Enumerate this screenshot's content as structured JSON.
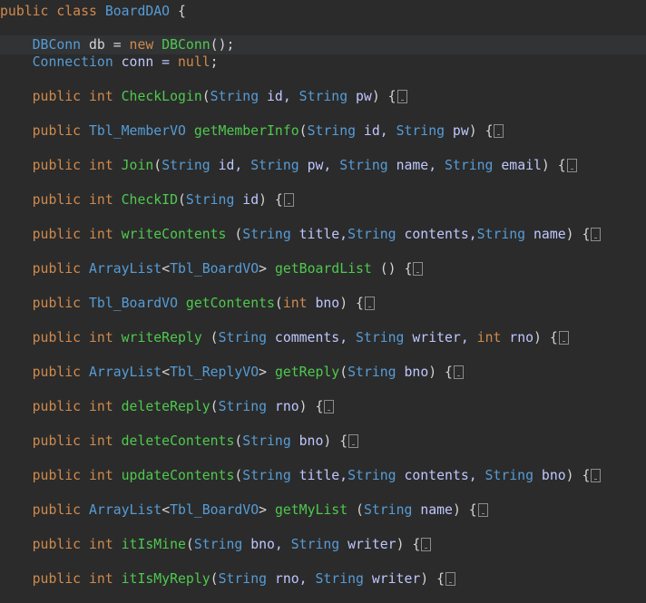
{
  "editor": {
    "colors": {
      "background": "#2b2b2b",
      "current_line": "#313335",
      "keyword": "#d08a4c",
      "type": "#569cd6",
      "method": "#4ec94e",
      "field": "#bfc7ff",
      "plain": "#d4d4d4"
    },
    "lines": [
      {
        "name": "class-declaration",
        "current": false,
        "collapsed": false,
        "tokens": [
          {
            "t": "public class ",
            "c": "keyword"
          },
          {
            "t": "BoardDAO",
            "c": "type"
          },
          {
            "t": " {",
            "c": "plain"
          }
        ]
      },
      {
        "name": "field-db",
        "current": true,
        "collapsed": false,
        "tokens": [
          {
            "t": "    ",
            "c": "plain"
          },
          {
            "t": "DBConn",
            "c": "type"
          },
          {
            "t": " db = ",
            "c": "plain"
          },
          {
            "t": "new",
            "c": "keyword"
          },
          {
            "t": " ",
            "c": "plain"
          },
          {
            "t": "DBConn",
            "c": "method"
          },
          {
            "t": "();",
            "c": "plain"
          }
        ]
      },
      {
        "name": "field-conn",
        "current": false,
        "collapsed": false,
        "tokens": [
          {
            "t": "    ",
            "c": "plain"
          },
          {
            "t": "Connection",
            "c": "type"
          },
          {
            "t": " conn = ",
            "c": "field"
          },
          {
            "t": "null",
            "c": "keyword"
          },
          {
            "t": ";",
            "c": "plain"
          }
        ]
      },
      {
        "name": "method-checklogin",
        "current": false,
        "collapsed": true,
        "tokens": [
          {
            "t": "    ",
            "c": "plain"
          },
          {
            "t": "public int ",
            "c": "keyword"
          },
          {
            "t": "CheckLogin",
            "c": "method"
          },
          {
            "t": "(",
            "c": "plain"
          },
          {
            "t": "String",
            "c": "type"
          },
          {
            "t": " id, ",
            "c": "field"
          },
          {
            "t": "String",
            "c": "type"
          },
          {
            "t": " pw",
            "c": "field"
          },
          {
            "t": ") {",
            "c": "plain"
          }
        ]
      },
      {
        "name": "method-getmemberinfo",
        "current": false,
        "collapsed": true,
        "tokens": [
          {
            "t": "    ",
            "c": "plain"
          },
          {
            "t": "public ",
            "c": "keyword"
          },
          {
            "t": "Tbl_MemberVO",
            "c": "type"
          },
          {
            "t": " ",
            "c": "plain"
          },
          {
            "t": "getMemberInfo",
            "c": "method"
          },
          {
            "t": "(",
            "c": "plain"
          },
          {
            "t": "String",
            "c": "type"
          },
          {
            "t": " id, ",
            "c": "field"
          },
          {
            "t": "String",
            "c": "type"
          },
          {
            "t": " pw",
            "c": "field"
          },
          {
            "t": ") {",
            "c": "plain"
          }
        ]
      },
      {
        "name": "method-join",
        "current": false,
        "collapsed": true,
        "tokens": [
          {
            "t": "    ",
            "c": "plain"
          },
          {
            "t": "public int ",
            "c": "keyword"
          },
          {
            "t": "Join",
            "c": "method"
          },
          {
            "t": "(",
            "c": "plain"
          },
          {
            "t": "String",
            "c": "type"
          },
          {
            "t": " id, ",
            "c": "field"
          },
          {
            "t": "String",
            "c": "type"
          },
          {
            "t": " pw, ",
            "c": "field"
          },
          {
            "t": "String",
            "c": "type"
          },
          {
            "t": " name, ",
            "c": "field"
          },
          {
            "t": "String",
            "c": "type"
          },
          {
            "t": " email",
            "c": "field"
          },
          {
            "t": ") {",
            "c": "plain"
          }
        ]
      },
      {
        "name": "method-checkid",
        "current": false,
        "collapsed": true,
        "tokens": [
          {
            "t": "    ",
            "c": "plain"
          },
          {
            "t": "public int ",
            "c": "keyword"
          },
          {
            "t": "CheckID",
            "c": "method"
          },
          {
            "t": "(",
            "c": "plain"
          },
          {
            "t": "String",
            "c": "type"
          },
          {
            "t": " id",
            "c": "field"
          },
          {
            "t": ") {",
            "c": "plain"
          }
        ]
      },
      {
        "name": "method-writecontents",
        "current": false,
        "collapsed": true,
        "tokens": [
          {
            "t": "    ",
            "c": "plain"
          },
          {
            "t": "public int ",
            "c": "keyword"
          },
          {
            "t": "writeContents",
            "c": "method"
          },
          {
            "t": " (",
            "c": "plain"
          },
          {
            "t": "String",
            "c": "type"
          },
          {
            "t": " title,",
            "c": "field"
          },
          {
            "t": "String",
            "c": "type"
          },
          {
            "t": " contents,",
            "c": "field"
          },
          {
            "t": "String",
            "c": "type"
          },
          {
            "t": " name",
            "c": "field"
          },
          {
            "t": ") {",
            "c": "plain"
          }
        ]
      },
      {
        "name": "method-getboardlist",
        "current": false,
        "collapsed": true,
        "tokens": [
          {
            "t": "    ",
            "c": "plain"
          },
          {
            "t": "public ",
            "c": "keyword"
          },
          {
            "t": "ArrayList",
            "c": "type"
          },
          {
            "t": "<",
            "c": "plain"
          },
          {
            "t": "Tbl_BoardVO",
            "c": "type"
          },
          {
            "t": "> ",
            "c": "plain"
          },
          {
            "t": "getBoardList",
            "c": "method"
          },
          {
            "t": " () {",
            "c": "plain"
          }
        ]
      },
      {
        "name": "method-getcontents",
        "current": false,
        "collapsed": true,
        "tokens": [
          {
            "t": "    ",
            "c": "plain"
          },
          {
            "t": "public ",
            "c": "keyword"
          },
          {
            "t": "Tbl_BoardVO",
            "c": "type"
          },
          {
            "t": " ",
            "c": "plain"
          },
          {
            "t": "getContents",
            "c": "method"
          },
          {
            "t": "(",
            "c": "plain"
          },
          {
            "t": "int",
            "c": "keyword"
          },
          {
            "t": " bno",
            "c": "field"
          },
          {
            "t": ") {",
            "c": "plain"
          }
        ]
      },
      {
        "name": "method-writereply",
        "current": false,
        "collapsed": true,
        "tokens": [
          {
            "t": "    ",
            "c": "plain"
          },
          {
            "t": "public int ",
            "c": "keyword"
          },
          {
            "t": "writeReply",
            "c": "method"
          },
          {
            "t": " (",
            "c": "plain"
          },
          {
            "t": "String",
            "c": "type"
          },
          {
            "t": " comments, ",
            "c": "field"
          },
          {
            "t": "String",
            "c": "type"
          },
          {
            "t": " writer, ",
            "c": "field"
          },
          {
            "t": "int",
            "c": "keyword"
          },
          {
            "t": " rno",
            "c": "field"
          },
          {
            "t": ") {",
            "c": "plain"
          }
        ]
      },
      {
        "name": "method-getreply",
        "current": false,
        "collapsed": true,
        "tokens": [
          {
            "t": "    ",
            "c": "plain"
          },
          {
            "t": "public ",
            "c": "keyword"
          },
          {
            "t": "ArrayList",
            "c": "type"
          },
          {
            "t": "<",
            "c": "plain"
          },
          {
            "t": "Tbl_ReplyVO",
            "c": "type"
          },
          {
            "t": "> ",
            "c": "plain"
          },
          {
            "t": "getReply",
            "c": "method"
          },
          {
            "t": "(",
            "c": "plain"
          },
          {
            "t": "String",
            "c": "type"
          },
          {
            "t": " bno",
            "c": "field"
          },
          {
            "t": ") {",
            "c": "plain"
          }
        ]
      },
      {
        "name": "method-deletereply",
        "current": false,
        "collapsed": true,
        "tokens": [
          {
            "t": "    ",
            "c": "plain"
          },
          {
            "t": "public int ",
            "c": "keyword"
          },
          {
            "t": "deleteReply",
            "c": "method"
          },
          {
            "t": "(",
            "c": "plain"
          },
          {
            "t": "String",
            "c": "type"
          },
          {
            "t": " rno",
            "c": "field"
          },
          {
            "t": ") {",
            "c": "plain"
          }
        ]
      },
      {
        "name": "method-deletecontents",
        "current": false,
        "collapsed": true,
        "tokens": [
          {
            "t": "    ",
            "c": "plain"
          },
          {
            "t": "public int ",
            "c": "keyword"
          },
          {
            "t": "deleteContents",
            "c": "method"
          },
          {
            "t": "(",
            "c": "plain"
          },
          {
            "t": "String",
            "c": "type"
          },
          {
            "t": " bno",
            "c": "field"
          },
          {
            "t": ") {",
            "c": "plain"
          }
        ]
      },
      {
        "name": "method-updatecontents",
        "current": false,
        "collapsed": true,
        "tokens": [
          {
            "t": "    ",
            "c": "plain"
          },
          {
            "t": "public int ",
            "c": "keyword"
          },
          {
            "t": "updateContents",
            "c": "method"
          },
          {
            "t": "(",
            "c": "plain"
          },
          {
            "t": "String",
            "c": "type"
          },
          {
            "t": " title,",
            "c": "field"
          },
          {
            "t": "String",
            "c": "type"
          },
          {
            "t": " contents, ",
            "c": "field"
          },
          {
            "t": "String",
            "c": "type"
          },
          {
            "t": " bno",
            "c": "field"
          },
          {
            "t": ") {",
            "c": "plain"
          }
        ]
      },
      {
        "name": "method-getmylist",
        "current": false,
        "collapsed": true,
        "tokens": [
          {
            "t": "    ",
            "c": "plain"
          },
          {
            "t": "public ",
            "c": "keyword"
          },
          {
            "t": "ArrayList",
            "c": "type"
          },
          {
            "t": "<",
            "c": "plain"
          },
          {
            "t": "Tbl_BoardVO",
            "c": "type"
          },
          {
            "t": "> ",
            "c": "plain"
          },
          {
            "t": "getMyList",
            "c": "method"
          },
          {
            "t": " (",
            "c": "plain"
          },
          {
            "t": "String",
            "c": "type"
          },
          {
            "t": " name",
            "c": "field"
          },
          {
            "t": ") {",
            "c": "plain"
          }
        ]
      },
      {
        "name": "method-itismine",
        "current": false,
        "collapsed": true,
        "tokens": [
          {
            "t": "    ",
            "c": "plain"
          },
          {
            "t": "public int ",
            "c": "keyword"
          },
          {
            "t": "itIsMine",
            "c": "method"
          },
          {
            "t": "(",
            "c": "plain"
          },
          {
            "t": "String",
            "c": "type"
          },
          {
            "t": " bno, ",
            "c": "field"
          },
          {
            "t": "String",
            "c": "type"
          },
          {
            "t": " writer",
            "c": "field"
          },
          {
            "t": ") {",
            "c": "plain"
          }
        ]
      },
      {
        "name": "method-itismyreply",
        "current": false,
        "collapsed": true,
        "tokens": [
          {
            "t": "    ",
            "c": "plain"
          },
          {
            "t": "public int ",
            "c": "keyword"
          },
          {
            "t": "itIsMyReply",
            "c": "method"
          },
          {
            "t": "(",
            "c": "plain"
          },
          {
            "t": "String",
            "c": "type"
          },
          {
            "t": " rno, ",
            "c": "field"
          },
          {
            "t": "String",
            "c": "type"
          },
          {
            "t": " writer",
            "c": "field"
          },
          {
            "t": ") {",
            "c": "plain"
          }
        ]
      }
    ]
  }
}
